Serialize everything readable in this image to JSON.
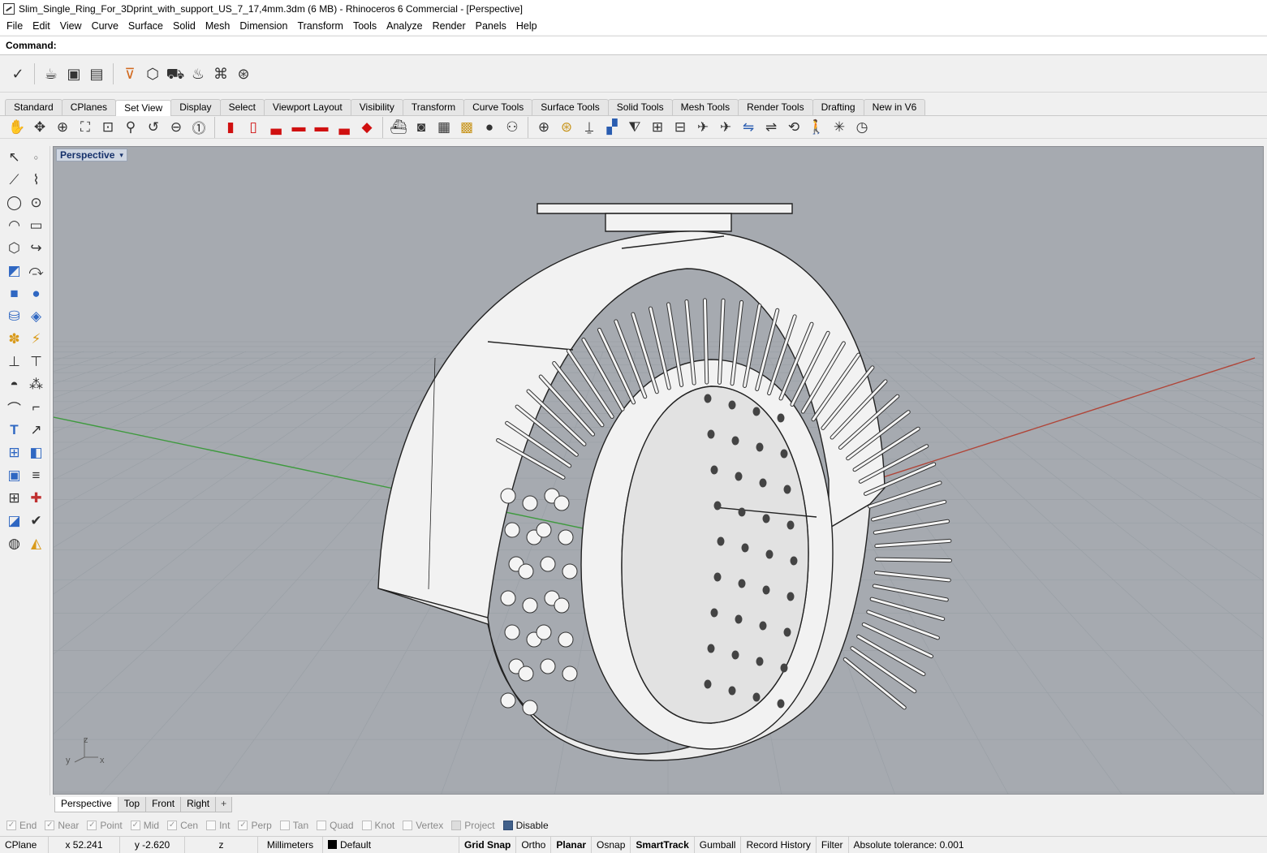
{
  "window": {
    "title": "Slim_Single_Ring_For_3Dprint_with_support_US_7_17,4mm.3dm (6 MB) - Rhinoceros 6 Commercial - [Perspective]"
  },
  "menu": [
    "File",
    "Edit",
    "View",
    "Curve",
    "Surface",
    "Solid",
    "Mesh",
    "Dimension",
    "Transform",
    "Tools",
    "Analyze",
    "Render",
    "Panels",
    "Help"
  ],
  "command": {
    "label": "Command:",
    "value": ""
  },
  "toolbar_tabs": {
    "items": [
      "Standard",
      "CPlanes",
      "Set View",
      "Display",
      "Select",
      "Viewport Layout",
      "Visibility",
      "Transform",
      "Curve Tools",
      "Surface Tools",
      "Solid Tools",
      "Mesh Tools",
      "Render Tools",
      "Drafting",
      "New in V6"
    ],
    "active": "Set View"
  },
  "viewport": {
    "label": "Perspective",
    "caret": "▾",
    "axis": {
      "z": "z",
      "y": "y",
      "x": "x"
    },
    "colors": {
      "background": "#a6aab0",
      "grid": "#9aa0a6",
      "x_axis": "#b04538",
      "y_axis": "#3e9a3e",
      "model": "#f2f2f2"
    }
  },
  "view_tabs": {
    "items": [
      "Perspective",
      "Top",
      "Front",
      "Right"
    ],
    "active": "Perspective",
    "add": "+"
  },
  "osnaps": [
    {
      "label": "End",
      "checked": true
    },
    {
      "label": "Near",
      "checked": true
    },
    {
      "label": "Point",
      "checked": true
    },
    {
      "label": "Mid",
      "checked": true
    },
    {
      "label": "Cen",
      "checked": true
    },
    {
      "label": "Int",
      "checked": false
    },
    {
      "label": "Perp",
      "checked": true
    },
    {
      "label": "Tan",
      "checked": false
    },
    {
      "label": "Quad",
      "checked": false
    },
    {
      "label": "Knot",
      "checked": false
    },
    {
      "label": "Vertex",
      "checked": false
    },
    {
      "label": "Project",
      "checked": false
    },
    {
      "label": "Disable",
      "checked": false
    }
  ],
  "status": {
    "cplane": "CPlane",
    "x": "x 52.241",
    "y": "y -2.620",
    "z": "z",
    "units": "Millimeters",
    "layer": "Default",
    "grid_snap": "Grid Snap",
    "ortho": "Ortho",
    "planar": "Planar",
    "osnap": "Osnap",
    "smarttrack": "SmartTrack",
    "gumball": "Gumball",
    "record_history": "Record History",
    "filter": "Filter",
    "tolerance": "Absolute tolerance: 0.001"
  }
}
